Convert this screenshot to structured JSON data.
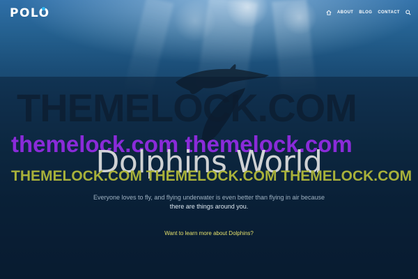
{
  "header": {
    "logo": "POLO",
    "nav": [
      {
        "label": "ABOUT"
      },
      {
        "label": "BLOG"
      },
      {
        "label": "CONTACT"
      }
    ]
  },
  "watermarks": {
    "line1": "THEMELOCK.COM",
    "line2": "themelock.com themelock.com",
    "line3": "THEMELOCK.COM THEMELOCK.COM THEMELOCK.COM"
  },
  "hero": {
    "title": "Dolphins World",
    "subtitle_line1": "Everyone loves to fly, and flying underwater is even better than flying in air because",
    "subtitle_line2": "there are things around you.",
    "cta": "Want to learn more about Dolphins?"
  },
  "colors": {
    "accent_dot": "#2eb6f0",
    "watermark_purple": "#8a2bd9",
    "watermark_olive": "#a8b13a",
    "cta_yellow": "#e3e06c"
  },
  "icons": [
    "home-icon",
    "search-icon"
  ]
}
